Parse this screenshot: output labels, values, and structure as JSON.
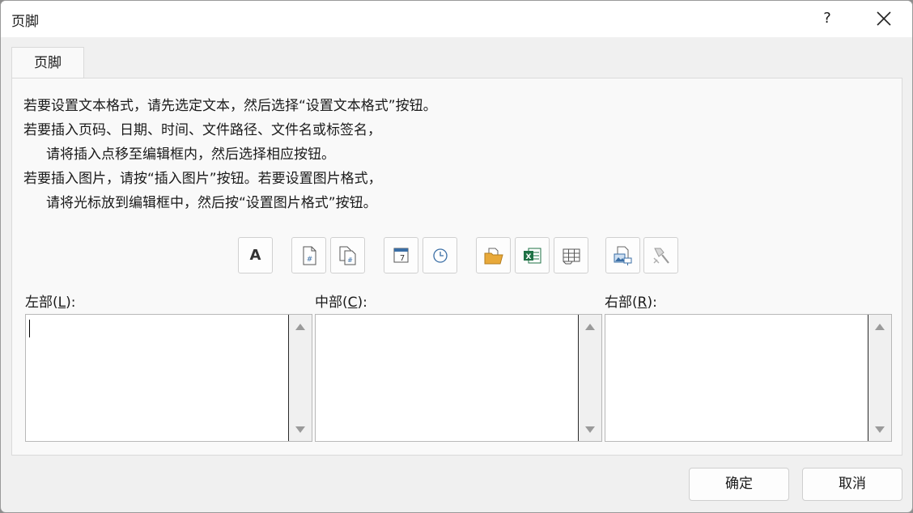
{
  "window": {
    "title": "页脚",
    "help_label": "?"
  },
  "tab": {
    "label": "页脚"
  },
  "instructions": [
    "若要设置文本格式，请先选定文本，然后选择“设置文本格式”按钮。",
    "若要插入页码、日期、时间、文件路径、文件名或标签名，",
    "请将插入点移至编辑框内，然后选择相应按钮。",
    "若要插入图片，请按“插入图片”按钮。若要设置图片格式，",
    "请将光标放到编辑框中，然后按“设置图片格式”按钮。"
  ],
  "toolbar": {
    "format_text_glyph": "A",
    "buttons": [
      "format-text-icon",
      "page-number-icon",
      "page-count-icon",
      "date-icon",
      "time-icon",
      "file-path-icon",
      "file-name-icon",
      "sheet-name-icon",
      "insert-picture-icon",
      "format-picture-icon"
    ]
  },
  "sections": {
    "left": {
      "label_pre": "左部(",
      "key": "L",
      "label_post": "):",
      "value": ""
    },
    "center": {
      "label_pre": "中部(",
      "key": "C",
      "label_post": "):",
      "value": ""
    },
    "right": {
      "label_pre": "右部(",
      "key": "R",
      "label_post": "):",
      "value": ""
    }
  },
  "footer": {
    "ok_label": "确定",
    "cancel_label": "取消"
  },
  "colors": {
    "excel_green": "#1e7145",
    "accent_blue": "#3a6ea5",
    "folder_orange": "#e8a93a"
  }
}
